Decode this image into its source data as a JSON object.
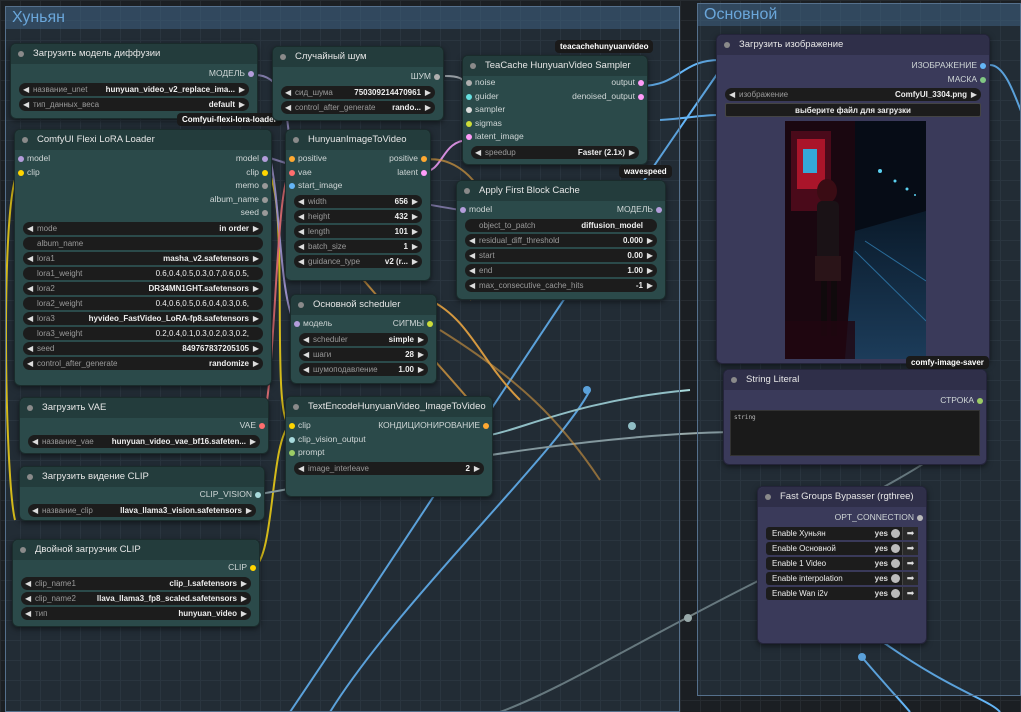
{
  "groups": {
    "left": {
      "title": "Хуньян"
    },
    "right": {
      "title": "Основной"
    }
  },
  "badges": {
    "teacache": "teacachehunyuanvideo",
    "lora_loader": "Comfyui-flexi-lora-loader",
    "wavespeed": "wavespeed",
    "image_saver": "comfy-image-saver"
  },
  "nodes": {
    "diffusion": {
      "title": "Загрузить модель диффузии",
      "out_model": "МОДЕЛЬ",
      "w_unet_label": "название_unet",
      "w_unet_value": "hunyuan_video_v2_replace_ima...",
      "w_dtype_label": "тип_данных_веса",
      "w_dtype_value": "default"
    },
    "noise": {
      "title": "Случайный шум",
      "out_noise": "ШУМ",
      "w_seed_label": "сид_шума",
      "w_seed_value": "750309214470961",
      "w_cag_label": "control_after_generate",
      "w_cag_value": "rando..."
    },
    "teacache": {
      "title": "TeaCache HunyuanVideo Sampler",
      "in": [
        "noise",
        "guider",
        "sampler",
        "sigmas",
        "latent_image"
      ],
      "out": [
        "output",
        "denoised_output"
      ],
      "w_speedup_label": "speedup",
      "w_speedup_value": "Faster (2.1x)"
    },
    "lora": {
      "title": "ComfyUI Flexi LoRA Loader",
      "in": [
        "model",
        "clip"
      ],
      "out": [
        "model",
        "clip",
        "memo",
        "album_name",
        "seed"
      ],
      "widgets": [
        {
          "label": "mode",
          "value": "in order",
          "arrows": true
        },
        {
          "label": "album_name",
          "value": "",
          "arrows": false
        },
        {
          "label": "lora1",
          "value": "masha_v2.safetensors",
          "arrows": true
        },
        {
          "label": "lora1_weight",
          "value": "0.6,0.4,0.5,0.3,0.7,0.6,0.5,",
          "arrows": false
        },
        {
          "label": "lora2",
          "value": "DR34MN1GHT.safetensors",
          "arrows": true
        },
        {
          "label": "lora2_weight",
          "value": "0.4,0.6,0.5,0.6,0.4,0.3,0.6,",
          "arrows": false
        },
        {
          "label": "lora3",
          "value": "hyvideo_FastVideo_LoRA-fp8.safetensors",
          "arrows": true
        },
        {
          "label": "lora3_weight",
          "value": "0.2,0.4,0.1,0.3,0.2,0.3,0.2,",
          "arrows": false
        },
        {
          "label": "seed",
          "value": "849767837205105",
          "arrows": true
        },
        {
          "label": "control_after_generate",
          "value": "randomize",
          "arrows": true
        }
      ]
    },
    "i2v": {
      "title": "HunyuanImageToVideo",
      "in": [
        "positive",
        "vae",
        "start_image"
      ],
      "out": [
        "positive",
        "latent"
      ],
      "widgets": [
        {
          "label": "width",
          "value": "656"
        },
        {
          "label": "height",
          "value": "432"
        },
        {
          "label": "length",
          "value": "101"
        },
        {
          "label": "batch_size",
          "value": "1"
        },
        {
          "label": "guidance_type",
          "value": "v2 (r..."
        }
      ]
    },
    "fbc": {
      "title": "Apply First Block Cache",
      "in_model": "model",
      "out_model": "МОДЕЛЬ",
      "widgets": [
        {
          "label": "object_to_patch",
          "value": "diffusion_model",
          "arrows": false
        },
        {
          "label": "residual_diff_threshold",
          "value": "0.000",
          "arrows": true
        },
        {
          "label": "start",
          "value": "0.00",
          "arrows": true
        },
        {
          "label": "end",
          "value": "1.00",
          "arrows": true
        },
        {
          "label": "max_consecutive_cache_hits",
          "value": "-1",
          "arrows": true
        }
      ]
    },
    "sched": {
      "title": "Основной scheduler",
      "in_model": "модель",
      "out_sigmas": "СИГМЫ",
      "widgets": [
        {
          "label": "scheduler",
          "value": "simple"
        },
        {
          "label": "шаги",
          "value": "28"
        },
        {
          "label": "шумоподавление",
          "value": "1.00"
        }
      ]
    },
    "vae": {
      "title": "Загрузить VAE",
      "out": "VAE",
      "w_label": "название_vae",
      "w_value": "hunyuan_video_vae_bf16.safeten..."
    },
    "encode": {
      "title": "TextEncodeHunyuanVideo_ImageToVideo",
      "in": [
        "clip",
        "clip_vision_output",
        "prompt"
      ],
      "out": "КОНДИЦИОНИРОВАНИЕ",
      "w_label": "image_interleave",
      "w_value": "2"
    },
    "clipvision": {
      "title": "Загрузить видение CLIP",
      "out": "CLIP_VISION",
      "w_label": "название_clip",
      "w_value": "llava_llama3_vision.safetensors"
    },
    "dualclip": {
      "title": "Двойной загрузчик CLIP",
      "out": "CLIP",
      "widgets": [
        {
          "label": "clip_name1",
          "value": "clip_l.safetensors"
        },
        {
          "label": "clip_name2",
          "value": "llava_llama3_fp8_scaled.safetensors"
        },
        {
          "label": "тип",
          "value": "hunyuan_video"
        }
      ]
    },
    "loadimage": {
      "title": "Загрузить изображение",
      "out": [
        "ИЗОБРАЖЕНИЕ",
        "МАСКА"
      ],
      "w_label": "изображение",
      "w_value": "ComfyUI_3304.png",
      "upload_label": "выберите файл для загрузки"
    },
    "string": {
      "title": "String Literal",
      "out": "СТРОКА",
      "placeholder": "string"
    },
    "bypasser": {
      "title": "Fast Groups Bypasser (rgthree)",
      "out": "OPT_CONNECTION",
      "toggles": [
        {
          "label": "Enable Хуньян",
          "state": "yes"
        },
        {
          "label": "Enable Основной",
          "state": "yes"
        },
        {
          "label": "Enable 1 Video",
          "state": "yes"
        },
        {
          "label": "Enable interpolation",
          "state": "yes"
        },
        {
          "label": "Enable Wan i2v",
          "state": "yes"
        }
      ]
    }
  },
  "colors": {
    "model": "#b39ddb",
    "clip": "#ffd500",
    "vae": "#ff6e6e",
    "conditioning": "#ffa931",
    "latent": "#ff9cf9",
    "image": "#64b5f6",
    "noise": "#b0b0b0",
    "sigmas": "#cddc39",
    "clip_vision": "#a8dadc"
  }
}
